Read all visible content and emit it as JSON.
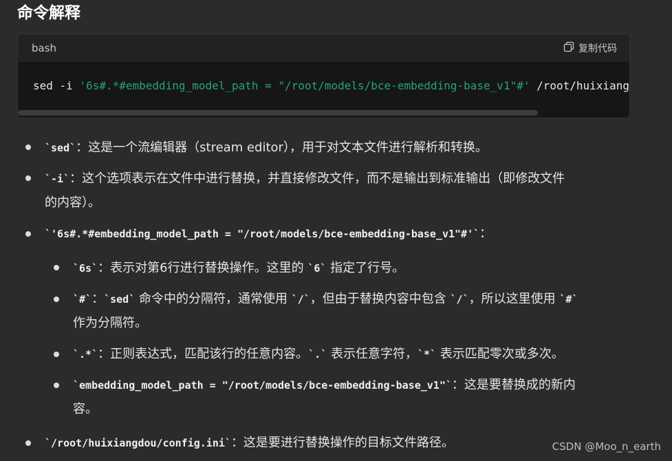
{
  "heading": "命令解释",
  "code_block": {
    "language": "bash",
    "copy_label": "复制代码",
    "cmd": "sed -i ",
    "string": "'6s#.*#embedding_model_path = \"/root/models/bce-embedding-base_v1\"#'",
    "path": " /root/huixiang"
  },
  "list": {
    "item1": {
      "code": "`sed`",
      "text": "：这是一个流编辑器（stream editor），用于对文本文件进行解析和转换。"
    },
    "item2": {
      "code": "`-i`",
      "text1": "：这个选项表示在文件中进行替换，并直接修改文件，而不是输出到标准输出（即修改文件",
      "text2": "的内容）。"
    },
    "item3": {
      "code": "`'6s#.*#embedding_model_path = \"/root/models/bce-embedding-base_v1\"#'`",
      "text": "："
    },
    "sub1": {
      "code1": "`6s`",
      "text1": "：表示对第6行进行替换操作。这里的 ",
      "code2": "`6`",
      "text2": " 指定了行号。"
    },
    "sub2": {
      "code1": "`#`",
      "text1": "：",
      "code2": "`sed`",
      "text2": " 命令中的分隔符，通常使用 ",
      "code3": "`/`",
      "text3": "，但由于替换内容中包含 ",
      "code4": "`/`",
      "text4": "，所以这里使用 ",
      "code5": "`#`",
      "text5": "作为分隔符。"
    },
    "sub3": {
      "code1": "`.*`",
      "text1": "：正则表达式，匹配该行的任意内容。",
      "code2": "`.`",
      "text2": " 表示任意字符，",
      "code3": "`*`",
      "text3": " 表示匹配零次或多次。"
    },
    "sub4": {
      "code1": "`embedding_model_path = \"/root/models/bce-embedding-base_v1\"`",
      "text1": "：这是要替换成的新内",
      "text2": "容。"
    },
    "item4": {
      "code": "`/root/huixiangdou/config.ini`",
      "text": "：这是要进行替换操作的目标文件路径。"
    }
  },
  "watermark": "CSDN @Moo_n_earth"
}
